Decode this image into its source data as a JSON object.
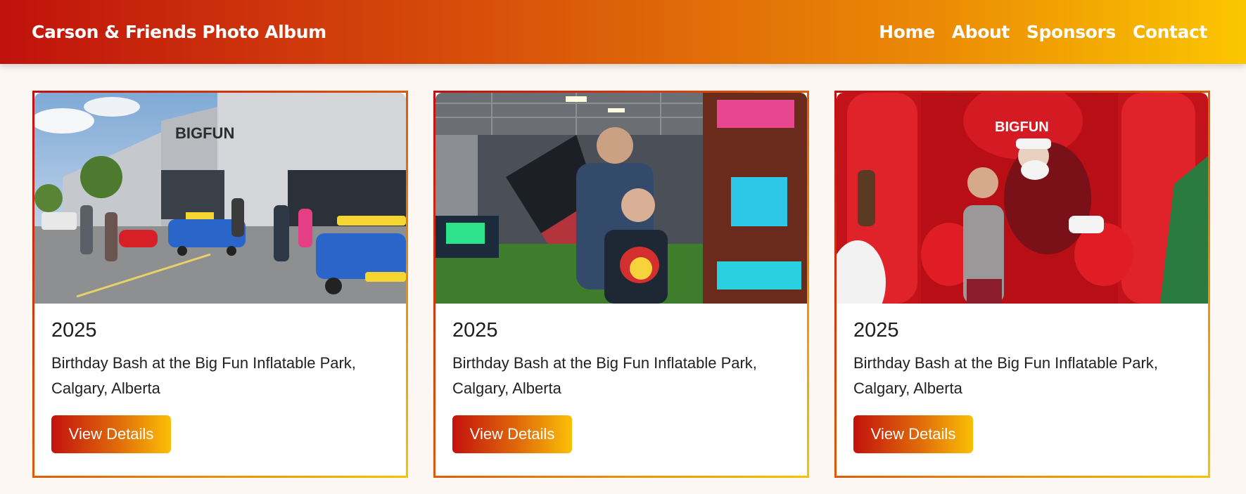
{
  "header": {
    "site_title": "Carson & Friends Photo Album",
    "nav": [
      "Home",
      "About",
      "Sponsors",
      "Contact"
    ]
  },
  "cards": [
    {
      "year": "2025",
      "description": "Birthday Bash at the Big Fun Inflatable Park, Calgary, Alberta",
      "button_label": "View Details",
      "photo_sign": "BIGFUN"
    },
    {
      "year": "2025",
      "description": "Birthday Bash at the Big Fun Inflatable Park, Calgary, Alberta",
      "button_label": "View Details"
    },
    {
      "year": "2025",
      "description": "Birthday Bash at the Big Fun Inflatable Park, Calgary, Alberta",
      "button_label": "View Details",
      "photo_sign": "BIGFUN"
    }
  ],
  "colors": {
    "gradient_start": "#c0120c",
    "gradient_end": "#fbc600",
    "page_background": "#fdf7f3"
  }
}
